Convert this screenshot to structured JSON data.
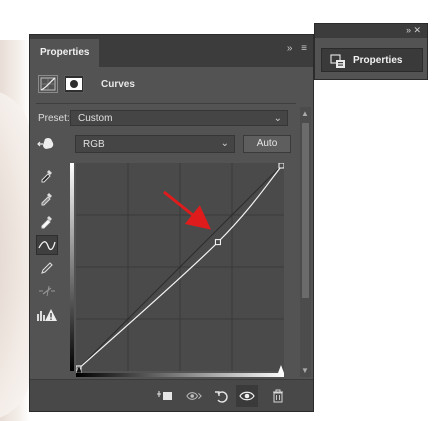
{
  "panel": {
    "tab_title": "Properties",
    "collapse_glyph": "»",
    "menu_glyph": "≡",
    "adjustment_label": "Curves",
    "preset_label": "Preset:",
    "preset_value": "Custom",
    "channel_value": "RGB",
    "auto_label": "Auto"
  },
  "curve": {
    "input_range": [
      0,
      255
    ],
    "output_range": [
      0,
      255
    ],
    "points": [
      [
        0,
        0
      ],
      [
        174,
        158
      ],
      [
        255,
        255
      ]
    ]
  },
  "annotation": {
    "arrow_color": "#e01b1b"
  },
  "dock": {
    "controls": "»  ✕",
    "button_label": "Properties"
  },
  "icons": {
    "adjustment_layer": "curves-adjustment-icon",
    "mask": "mask-icon",
    "target": "on-image-adjust-icon",
    "eyedropper_black": "black-point-eyedropper-icon",
    "eyedropper_gray": "gray-point-eyedropper-icon",
    "eyedropper_white": "white-point-eyedropper-icon",
    "curve_tool": "edit-points-curve-icon",
    "pencil": "pencil-draw-icon",
    "smooth": "smooth-curve-icon",
    "clipping": "clipping-warning-icon",
    "clip_layer": "clip-to-layer-icon",
    "view_previous": "view-previous-state-icon",
    "reset": "reset-icon",
    "visibility": "eye-icon",
    "delete": "trash-icon"
  }
}
